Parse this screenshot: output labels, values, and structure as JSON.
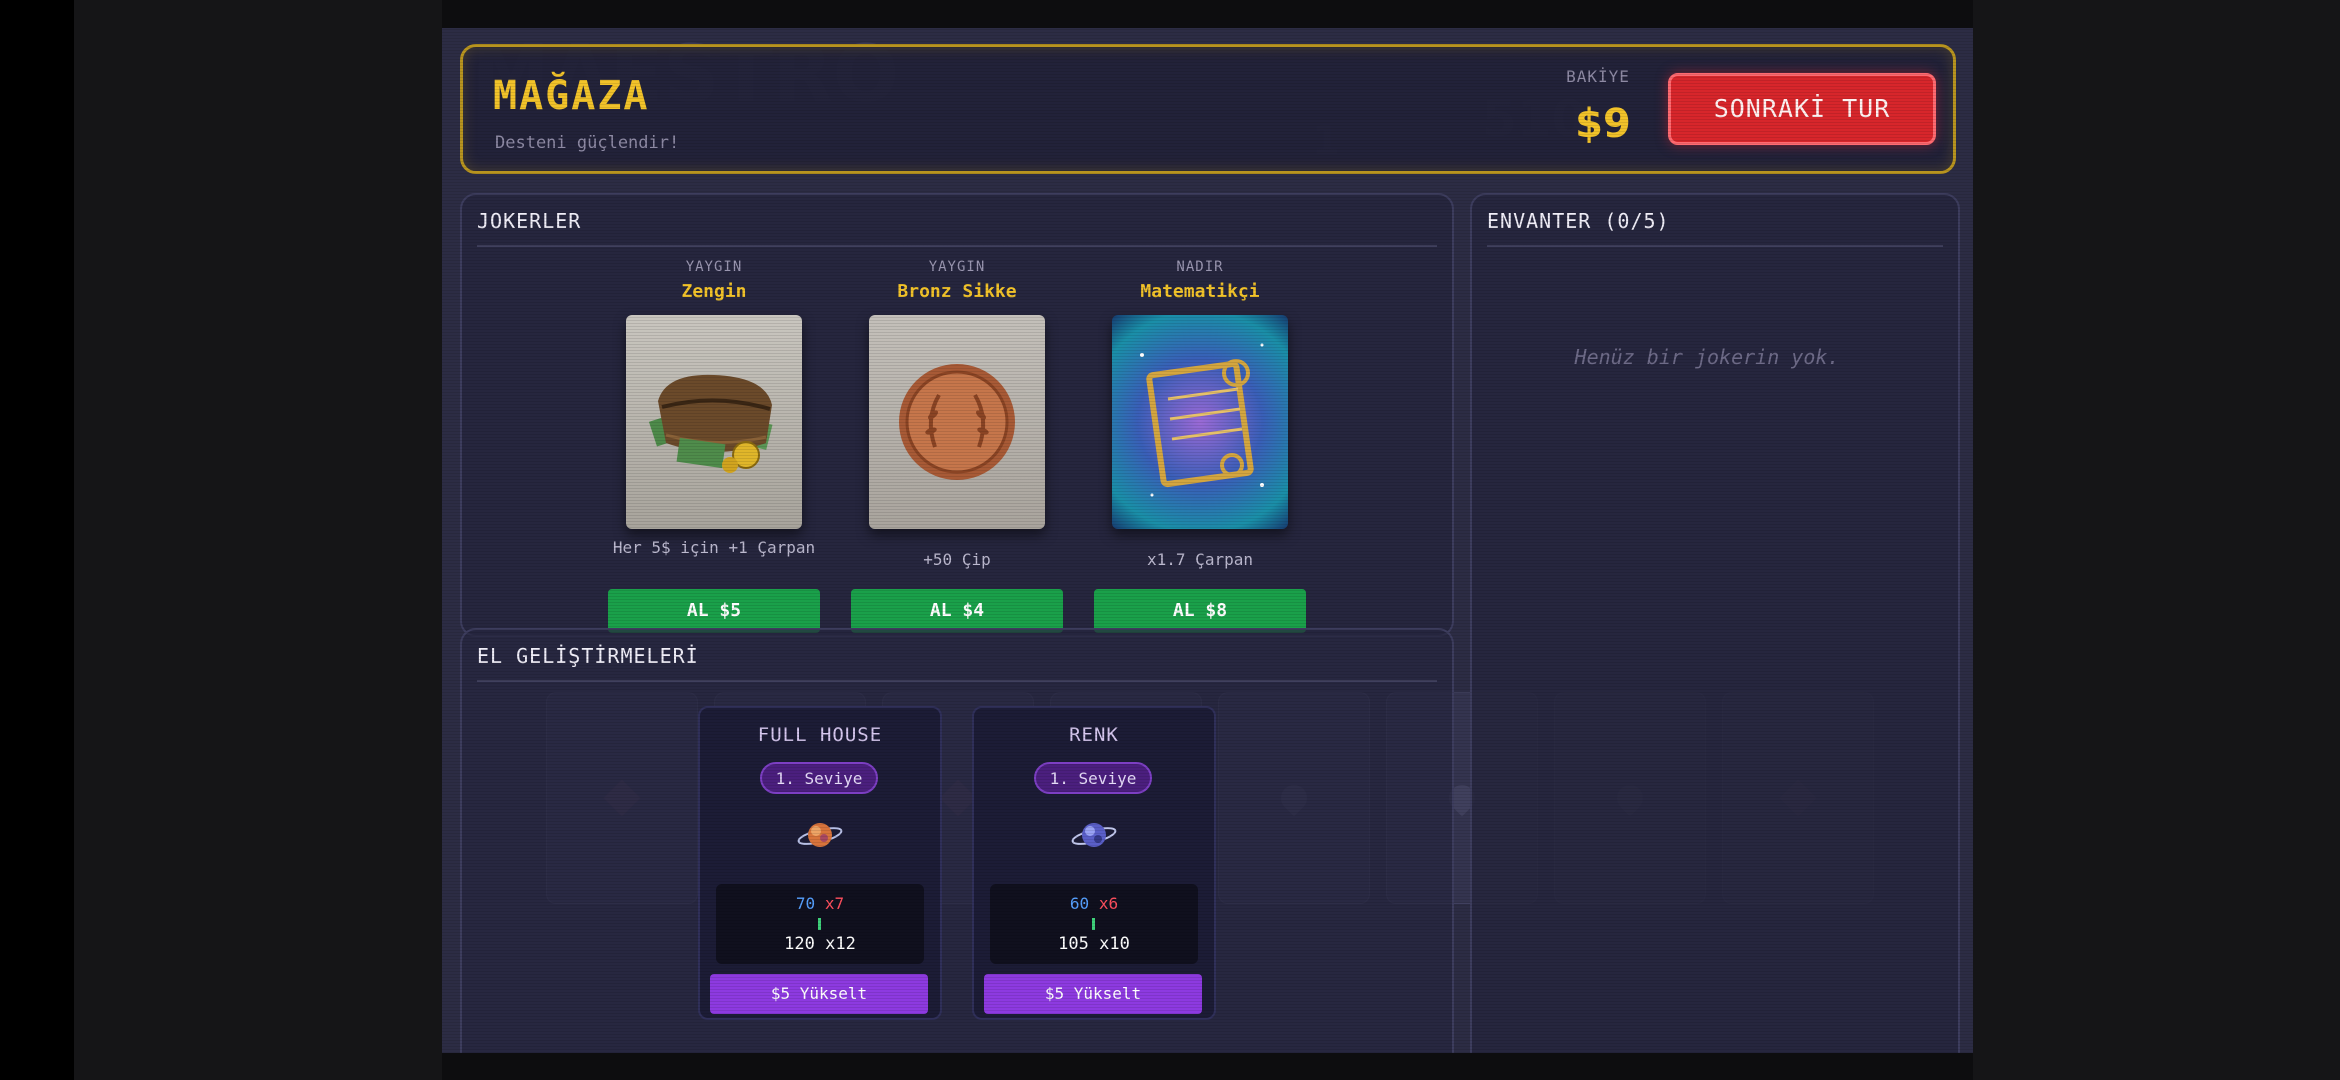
{
  "shop": {
    "title": "MAĞAZA",
    "subtitle": "Desteni güçlendir!"
  },
  "balance": {
    "label": "BAKİYE",
    "value": "$9"
  },
  "next_round_button": "SONRAKİ TUR",
  "jokers": {
    "title": "JOKERLER",
    "items": [
      {
        "rarity": "YAYGIN",
        "name": "Zengin",
        "description": "Her 5$ için +1 Çarpan",
        "buy_label": "AL $5",
        "art_icon": "wallet-icon"
      },
      {
        "rarity": "YAYGIN",
        "name": "Bronz Sikke",
        "description": "+50 Çip",
        "buy_label": "AL $4",
        "art_icon": "bronze-coin-icon"
      },
      {
        "rarity": "NADIR",
        "name": "Matematikçi",
        "description": "x1.7 Çarpan",
        "buy_label": "AL $8",
        "art_icon": "abacus-icon"
      }
    ]
  },
  "inventory": {
    "title": "ENVANTER (0/5)",
    "empty_message": "Henüz bir jokerin yok."
  },
  "upgrades": {
    "title": "EL GELİŞTİRMELERİ",
    "items": [
      {
        "name": "FULL HOUSE",
        "level": "1. Seviye",
        "chips": "70",
        "mult": "x7",
        "new_value": "120 x12",
        "button": "$5 Yükselt",
        "icon": "planet-orange-icon"
      },
      {
        "name": "RENK",
        "level": "1. Seviye",
        "chips": "60",
        "mult": "x6",
        "new_value": "105 x10",
        "button": "$5 Yükselt",
        "icon": "planet-blue-icon"
      }
    ]
  },
  "colors": {
    "accent_gold": "#f2c32a",
    "buy_green": "#1aa04a",
    "next_red": "#d7262b",
    "upgrade_purple": "#8d3ae0"
  }
}
